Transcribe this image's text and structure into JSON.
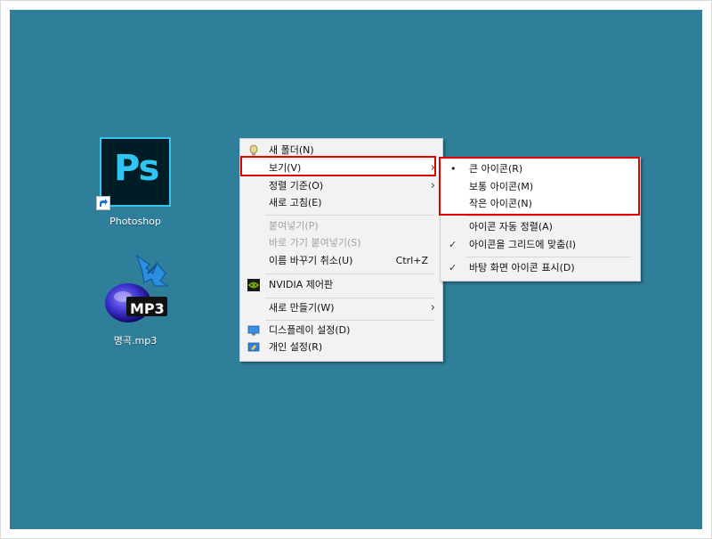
{
  "desktop": {
    "icons": [
      {
        "label": "Photoshop",
        "tile_text": "Ps"
      },
      {
        "label": "명곡.mp3",
        "badge_text": "MP3"
      }
    ]
  },
  "context_menu": {
    "items": [
      {
        "label": "새 폴더(N)"
      },
      {
        "label": "보기(V)",
        "submenu": true
      },
      {
        "label": "정렬 기준(O)",
        "submenu": true
      },
      {
        "label": "새로 고침(E)"
      },
      {
        "label": "붙여넣기(P)",
        "disabled": true
      },
      {
        "label": "바로 가기 붙여넣기(S)",
        "disabled": true
      },
      {
        "label": "이름 바꾸기 취소(U)",
        "shortcut": "Ctrl+Z"
      },
      {
        "label": "NVIDIA 제어판"
      },
      {
        "label": "새로 만들기(W)",
        "submenu": true
      },
      {
        "label": "디스플레이 설정(D)"
      },
      {
        "label": "개인 설정(R)"
      }
    ]
  },
  "view_submenu": {
    "items": [
      {
        "label": "큰 아이콘(R)",
        "mark": "•"
      },
      {
        "label": "보통 아이콘(M)"
      },
      {
        "label": "작은 아이콘(N)"
      },
      {
        "label": "아이콘 자동 정렬(A)"
      },
      {
        "label": "아이콘을 그리드에 맞춤(I)",
        "mark": "✓"
      },
      {
        "label": "바탕 화면 아이콘 표시(D)",
        "mark": "✓"
      }
    ]
  },
  "colors": {
    "desktop": "#2f7f9b",
    "highlight_border": "#e00000",
    "photoshop_accent": "#31c5f4"
  }
}
